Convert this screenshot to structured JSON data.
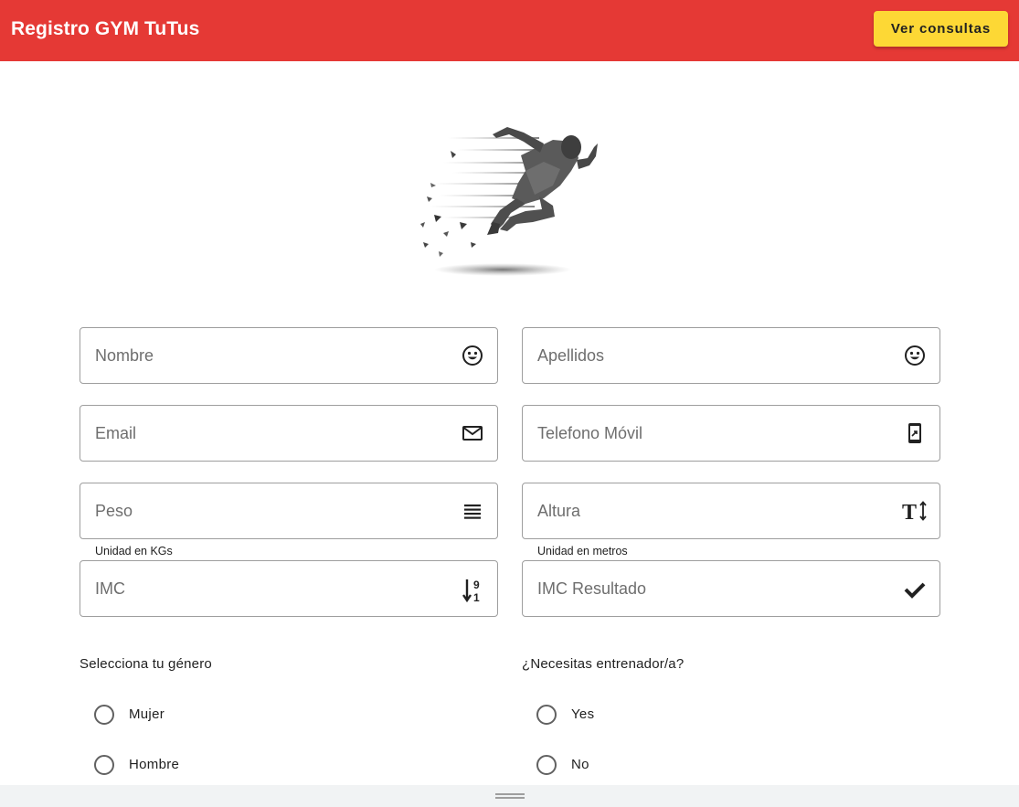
{
  "toolbar": {
    "title": "Registro GYM TuTus",
    "consult_button": "Ver consultas"
  },
  "hero": {
    "image": "runner-illustration"
  },
  "form": {
    "fields": {
      "nombre": {
        "placeholder": "Nombre",
        "icon": "smiley-icon"
      },
      "apellidos": {
        "placeholder": "Apellidos",
        "icon": "smiley-icon"
      },
      "email": {
        "placeholder": "Email",
        "icon": "mail-icon"
      },
      "telefono": {
        "placeholder": "Telefono Móvil",
        "icon": "mobile-phone-icon"
      },
      "peso": {
        "placeholder": "Peso",
        "hint": "Unidad en KGs",
        "icon": "lines-icon"
      },
      "altura": {
        "placeholder": "Altura",
        "hint": "Unidad en metros",
        "icon": "text-height-icon"
      },
      "imc": {
        "placeholder": "IMC",
        "icon": "sort-numeric-down-icon"
      },
      "imc_resultado": {
        "placeholder": "IMC Resultado",
        "icon": "check-icon"
      }
    },
    "gender": {
      "label": "Selecciona tu género",
      "options": [
        "Mujer",
        "Hombre"
      ]
    },
    "trainer": {
      "label": "¿Necesitas entrenador/a?",
      "options": [
        "Yes",
        "No"
      ]
    }
  },
  "colors": {
    "toolbar": "#e53935",
    "button": "#fdd835"
  }
}
